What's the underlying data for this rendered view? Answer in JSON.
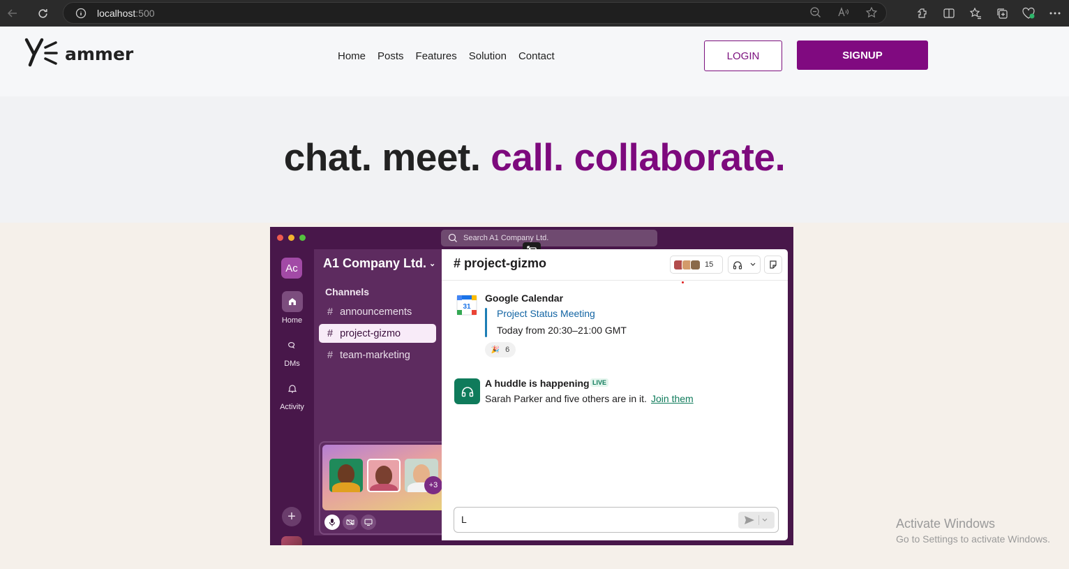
{
  "browser": {
    "url_host": "localhost",
    "url_port": ":500"
  },
  "site": {
    "logo_text": "ammer",
    "nav": [
      "Home",
      "Posts",
      "Features",
      "Solution",
      "Contact"
    ],
    "login_label": "LOGIN",
    "signup_label": "SIGNUP",
    "accent_color": "#800a80"
  },
  "hero": {
    "part1": "chat. meet. ",
    "part2": "call. collaborate."
  },
  "app": {
    "search_placeholder": "Search A1 Company Ltd.",
    "workspace_initials": "Ac",
    "workspace_name": "A1 Company Ltd.",
    "rail": {
      "home": "Home",
      "dms": "DMs",
      "activity": "Activity"
    },
    "channels_heading": "Channels",
    "channels": [
      {
        "name": "announcements",
        "active": false
      },
      {
        "name": "project-gizmo",
        "active": true
      },
      {
        "name": "team-marketing",
        "active": false
      }
    ],
    "channel_title": "# project-gizmo",
    "member_count": "15",
    "huddle_more": "+3",
    "messages": {
      "gcal_author": "Google Calendar",
      "gcal_icon_text": "31",
      "event_title": "Project Status Meeting",
      "event_time": "Today from 20:30–21:00 GMT",
      "reaction_emoji": "🎉",
      "reaction_count": "6",
      "huddle_title": "A huddle is happening",
      "live_badge": "LIVE",
      "huddle_sub": "Sarah Parker and five others are in it.",
      "join_link": "Join them"
    },
    "composer_value": "L"
  },
  "watermark": {
    "line1": "Activate Windows",
    "line2": "Go to Settings to activate Windows."
  }
}
